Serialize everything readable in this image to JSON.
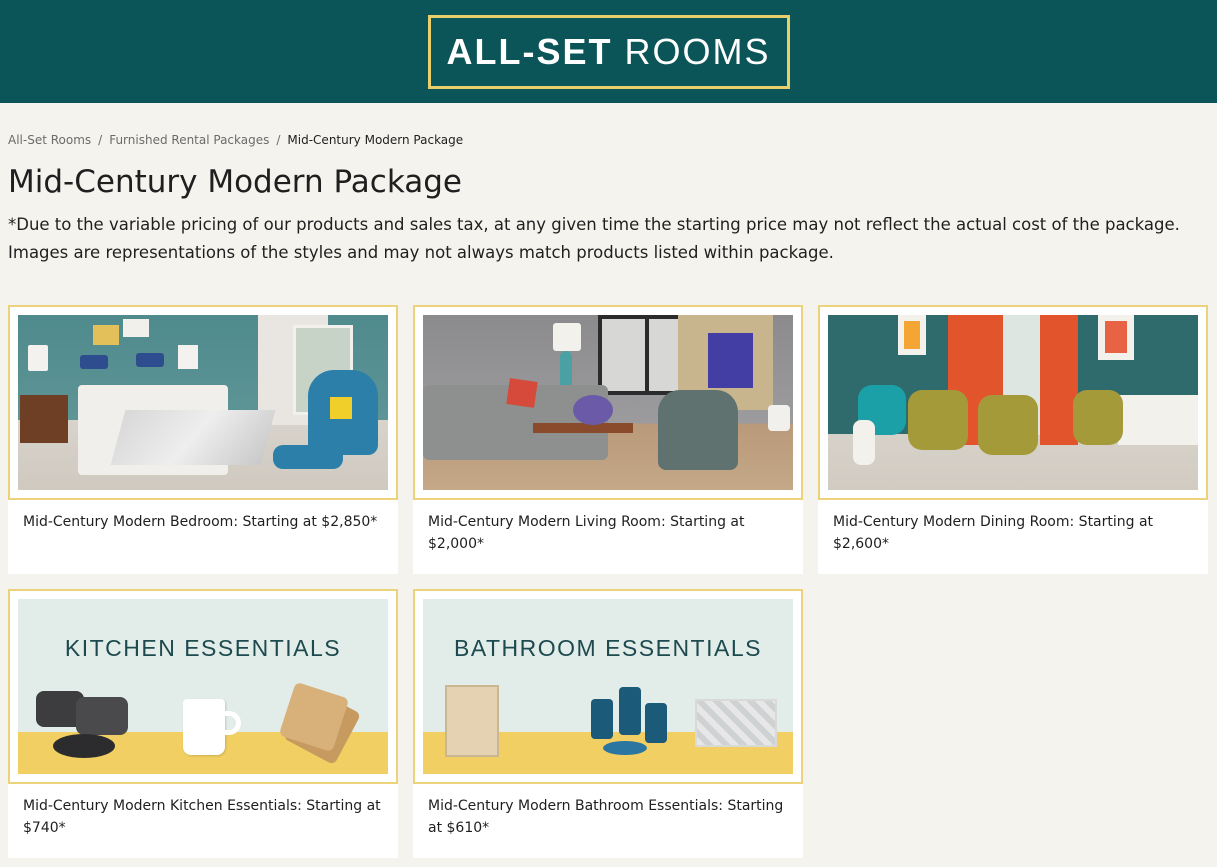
{
  "header": {
    "logo_bold": "ALL-SET",
    "logo_light": "ROOMS",
    "bg_color": "#0b5457",
    "logo_border_color": "#e8cf6c"
  },
  "breadcrumb": {
    "items": [
      "All-Set Rooms",
      "Furnished Rental Packages",
      "Mid-Century Modern Package"
    ],
    "separator": "/"
  },
  "page": {
    "title": "Mid-Century Modern Package",
    "disclaimer_line1": "*Due to the variable pricing of our products and sales tax, at any given time the starting price may not reflect the actual cost of the package.",
    "disclaimer_line2": "Images are representations of the styles and may not always match products listed within package."
  },
  "packages": [
    {
      "caption": "Mid-Century Modern Bedroom: Starting at $2,850*"
    },
    {
      "caption": "Mid-Century Modern Living Room: Starting at $2,000*"
    },
    {
      "caption": "Mid-Century Modern Dining Room: Starting at $2,600*"
    },
    {
      "caption": "Mid-Century Modern Kitchen Essentials: Starting at $740*",
      "banner_title": "KITCHEN ESSENTIALS"
    },
    {
      "caption": "Mid-Century Modern Bathroom Essentials: Starting at $610*",
      "banner_title": "BATHROOM ESSENTIALS"
    }
  ],
  "colors": {
    "card_border": "#ecd27a",
    "page_bg": "#f5f3ee",
    "banner_bg": "#e2ece9",
    "banner_stripe": "#f1cf63"
  }
}
